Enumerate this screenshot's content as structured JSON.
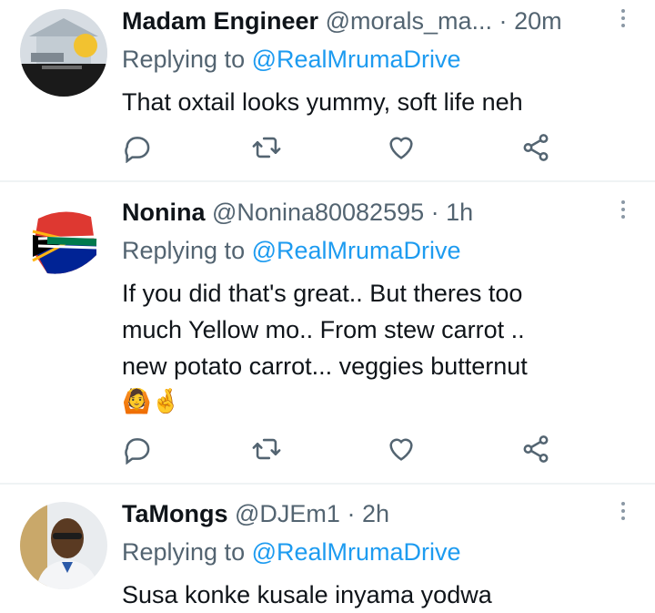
{
  "tweets": [
    {
      "name": "Madam Engineer",
      "handle": "@morals_ma...",
      "time": "20m",
      "replying_prefix": "Replying to",
      "replying_to": "@RealMrumaDrive",
      "lines": [
        "That oxtail looks yummy, soft life neh"
      ]
    },
    {
      "name": "Nonina",
      "handle": "@Nonina80082595",
      "time": "1h",
      "replying_prefix": "Replying to",
      "replying_to": "@RealMrumaDrive",
      "lines": [
        "If you did that's great.. But theres too",
        "much Yellow mo.. From stew carrot ..",
        "new potato carrot... veggies butternut"
      ],
      "emojis": "🙆🤞"
    },
    {
      "name": "TaMongs",
      "handle": "@DJEm1",
      "time": "2h",
      "replying_prefix": "Replying to",
      "replying_to": "@RealMrumaDrive",
      "lines": [
        "Susa konke kusale inyama yodwa"
      ]
    }
  ],
  "separator": "·",
  "icons": {
    "reply": "reply-icon",
    "retweet": "retweet-icon",
    "like": "like-icon",
    "share": "share-icon",
    "more": "more-icon"
  },
  "colors": {
    "text": "#0f1419",
    "secondary": "#536471",
    "accent": "#1d9bf0",
    "divider": "#eff3f4"
  }
}
